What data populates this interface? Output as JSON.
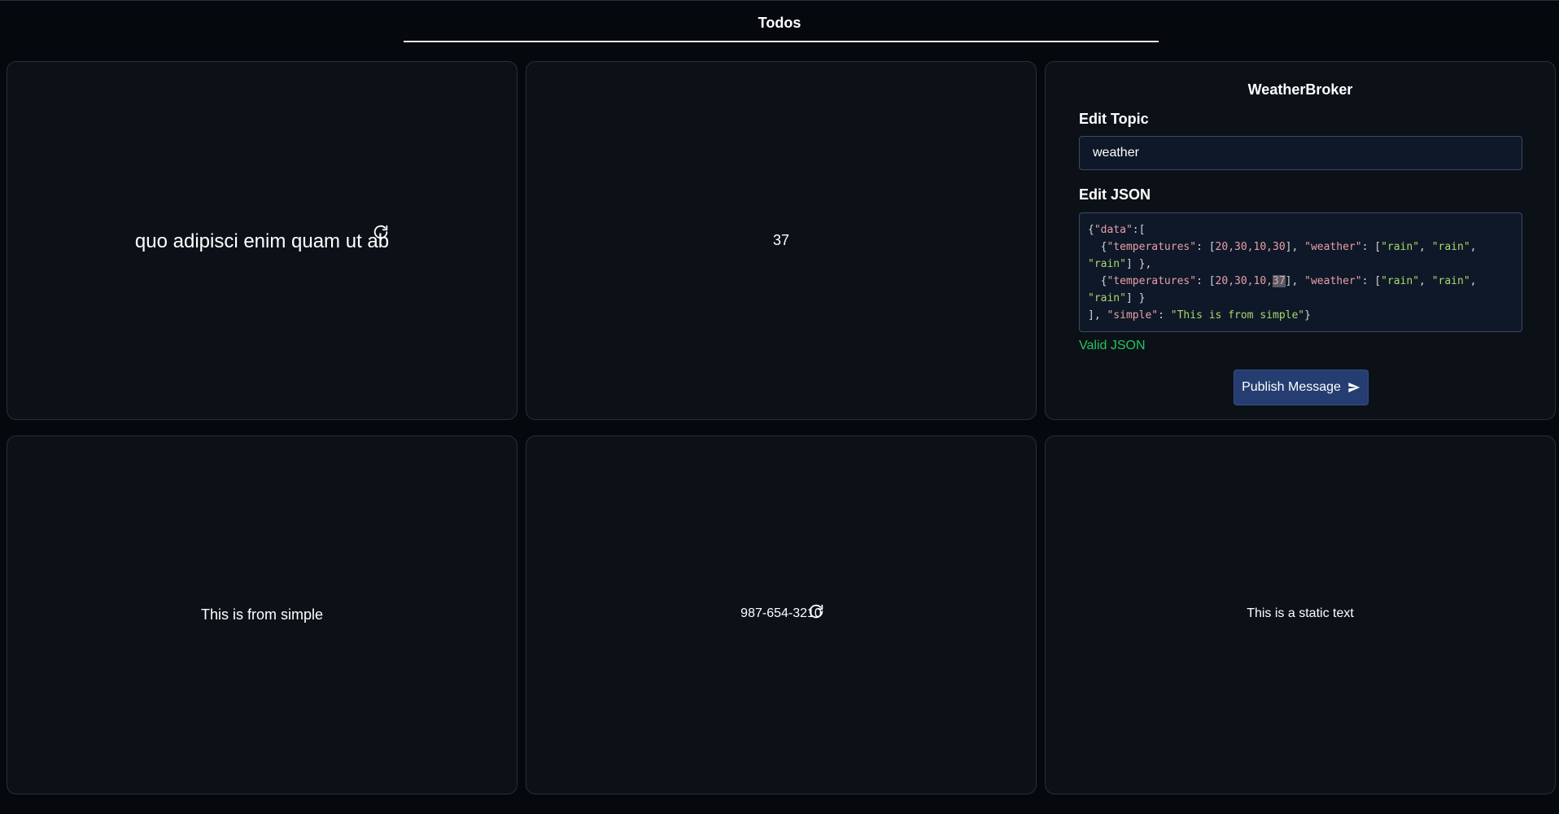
{
  "header": {
    "tab_title": "Todos"
  },
  "cards": {
    "card1_text": "quo adipisci enim quam ut ab",
    "card2_text": "37",
    "card4_text": "This is from simple",
    "card5_text": "987-654-3210",
    "card6_text": "This is a static text"
  },
  "editor": {
    "title": "WeatherBroker",
    "topic_label": "Edit Topic",
    "topic_value": "weather",
    "json_label": "Edit JSON",
    "json_tokens": {
      "open_brace": "{",
      "data_key": "\"data\"",
      "temperatures_key": "\"temperatures\"",
      "weather_key": "\"weather\"",
      "simple_key": "\"simple\"",
      "rain": "\"rain\"",
      "simple_value": "\"This is from simple\"",
      "temps_row1": "20,30,10,30",
      "temps_row2_prefix": "20,30,10,",
      "temps_row2_selected": "37"
    },
    "valid_text": "Valid JSON",
    "publish_label": "Publish Message"
  },
  "icons": {
    "refresh": "refresh-icon",
    "send": "send-icon"
  },
  "colors": {
    "background": "#05080d",
    "card": "#0c1117",
    "button": "#253d70",
    "valid": "#22c55e",
    "json_key": "#e6a0a6",
    "json_string": "#a8d96a"
  }
}
